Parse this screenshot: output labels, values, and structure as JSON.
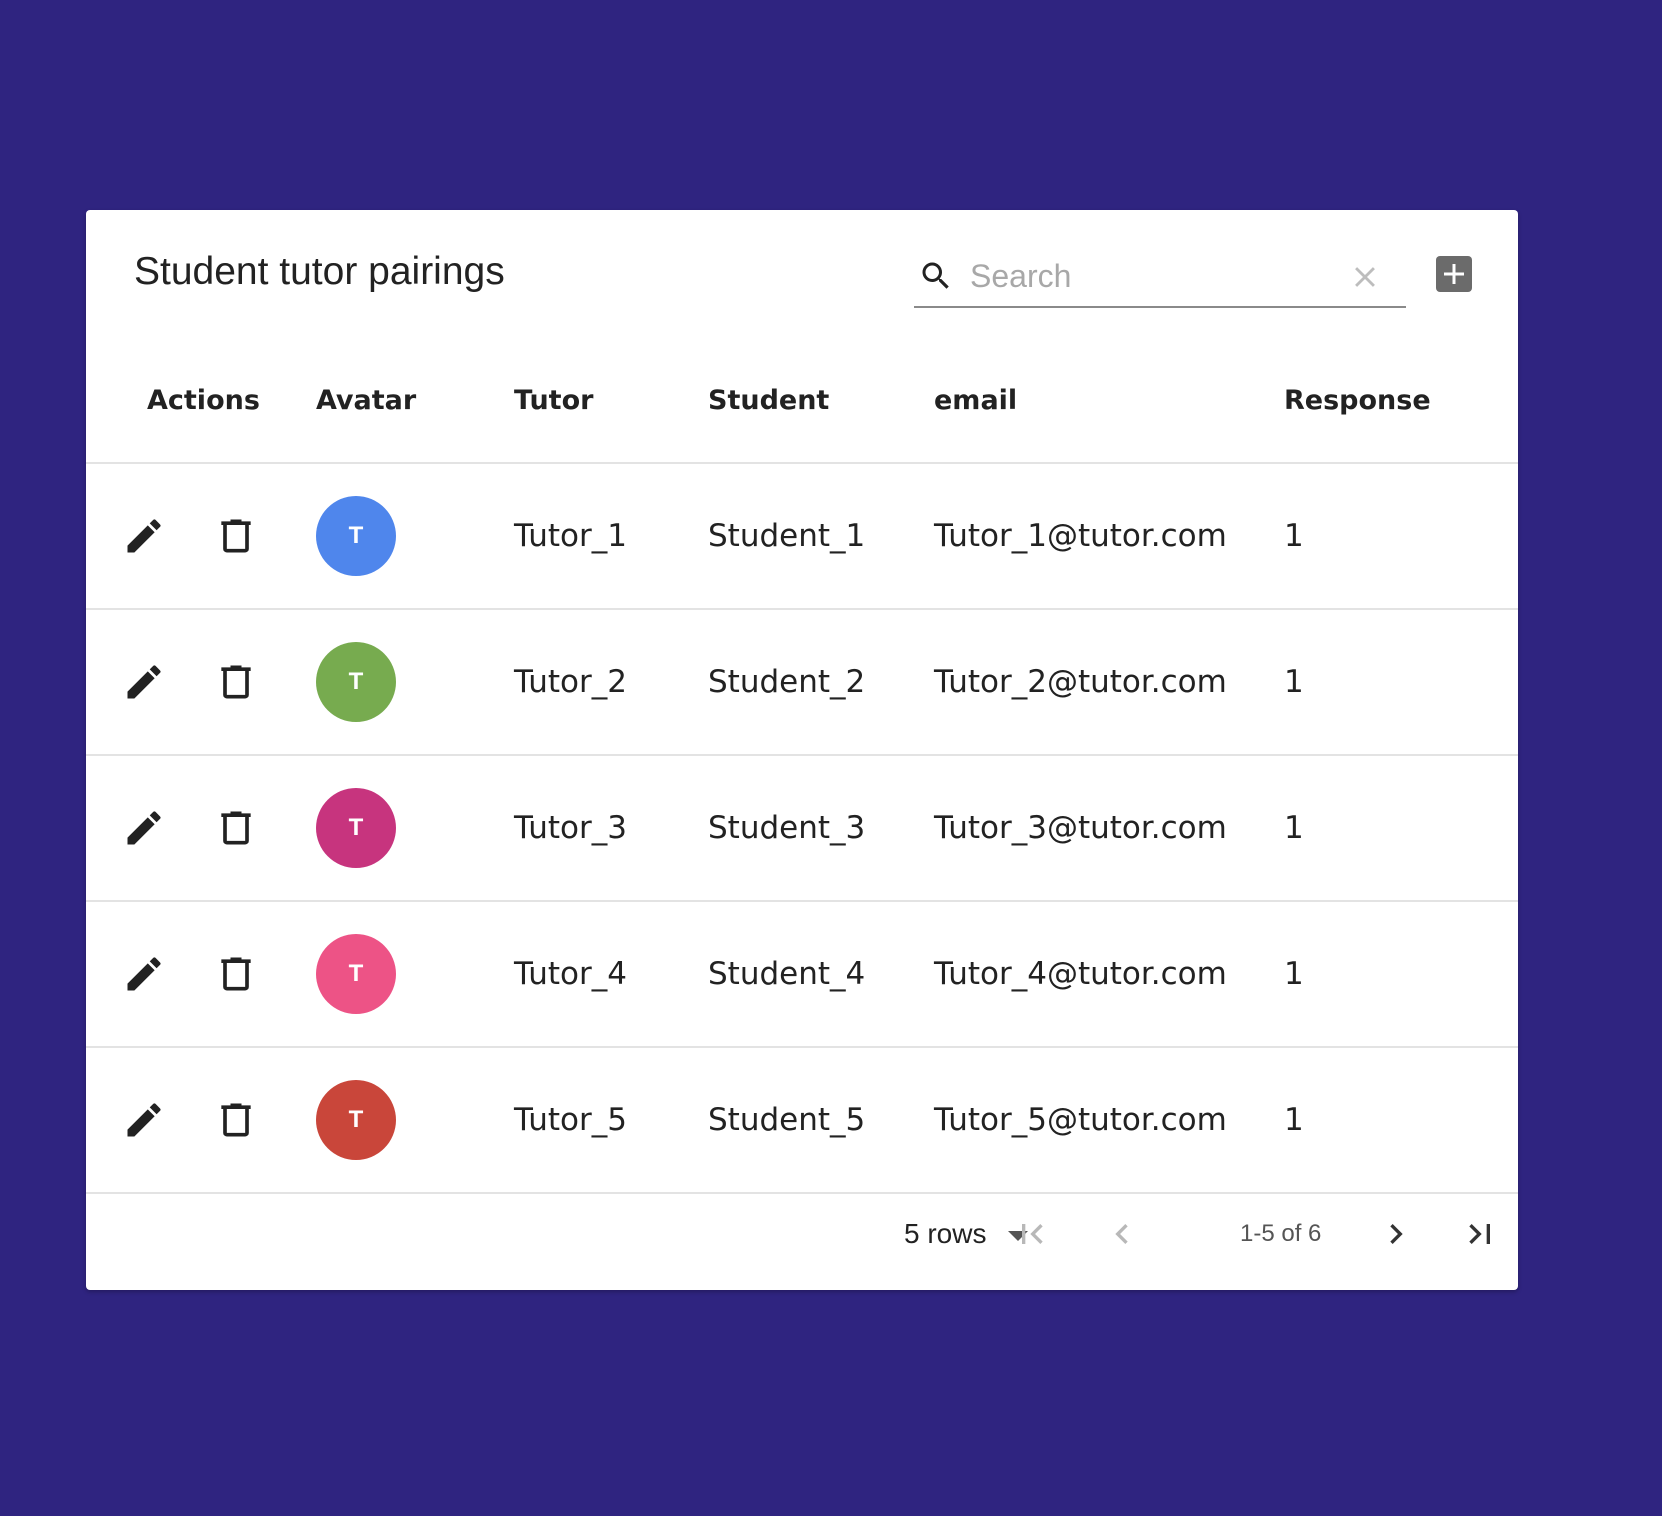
{
  "title": "Student tutor pairings",
  "search": {
    "placeholder": "Search",
    "value": ""
  },
  "columns": {
    "actions": "Actions",
    "avatar": "Avatar",
    "tutor": "Tutor",
    "student": "Student",
    "email": "email",
    "response": "Response"
  },
  "rows": [
    {
      "avatar_letter": "T",
      "avatar_color": "#4f86ec",
      "tutor": "Tutor_1",
      "student": "Student_1",
      "email": "Tutor_1@tutor.com",
      "response": "1"
    },
    {
      "avatar_letter": "T",
      "avatar_color": "#77ab4f",
      "tutor": "Tutor_2",
      "student": "Student_2",
      "email": "Tutor_2@tutor.com",
      "response": "1"
    },
    {
      "avatar_letter": "T",
      "avatar_color": "#c7347e",
      "tutor": "Tutor_3",
      "student": "Student_3",
      "email": "Tutor_3@tutor.com",
      "response": "1"
    },
    {
      "avatar_letter": "T",
      "avatar_color": "#ed5386",
      "tutor": "Tutor_4",
      "student": "Student_4",
      "email": "Tutor_4@tutor.com",
      "response": "1"
    },
    {
      "avatar_letter": "T",
      "avatar_color": "#c9463a",
      "tutor": "Tutor_5",
      "student": "Student_5",
      "email": "Tutor_5@tutor.com",
      "response": "1"
    }
  ],
  "pagination": {
    "rows_per_page": "5 rows",
    "page_info": "1-5 of 6"
  },
  "icons": {
    "search": "search-icon",
    "clear": "close-icon",
    "add": "add-box-icon",
    "edit": "pencil-icon",
    "delete": "trash-icon",
    "first_page": "first-page-icon",
    "previous_page": "chevron-left-icon",
    "next_page": "chevron-right-icon",
    "last_page": "last-page-icon"
  },
  "colors": {
    "background": "#2f2480",
    "card": "#ffffff",
    "divider": "#e3e3e3"
  }
}
